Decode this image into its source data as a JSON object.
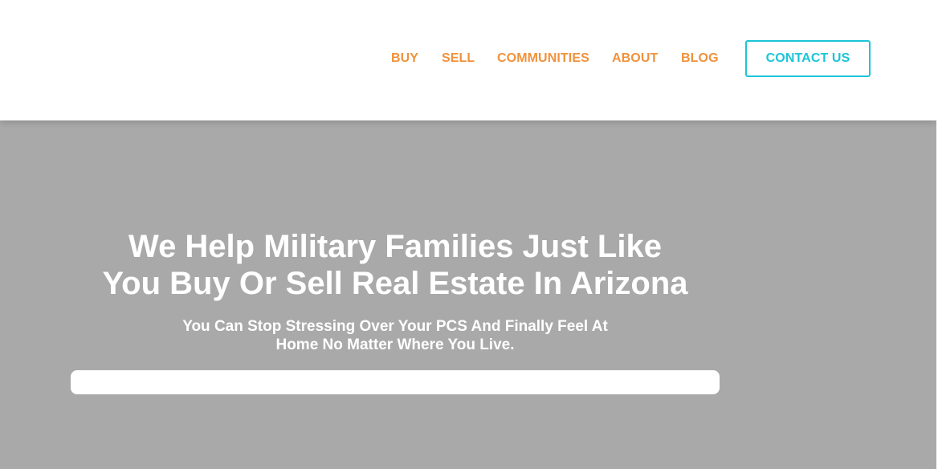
{
  "nav": {
    "items": [
      {
        "label": "BUY"
      },
      {
        "label": "SELL"
      },
      {
        "label": "COMMUNITIES"
      },
      {
        "label": "ABOUT"
      },
      {
        "label": "BLOG"
      }
    ],
    "cta_label": "CONTACT US"
  },
  "hero": {
    "title_line1": "We Help Military Families Just Like",
    "title_line2": "You Buy Or Sell Real Estate In Arizona",
    "subtitle_line1": "You Can Stop Stressing Over Your PCS And Finally Feel At",
    "subtitle_line2": "Home No Matter Where You Live."
  },
  "colors": {
    "nav_link": "#f0923c",
    "cta_accent": "#1cc5d8",
    "hero_background": "#a9a9a9",
    "header_background": "#ffffff"
  }
}
